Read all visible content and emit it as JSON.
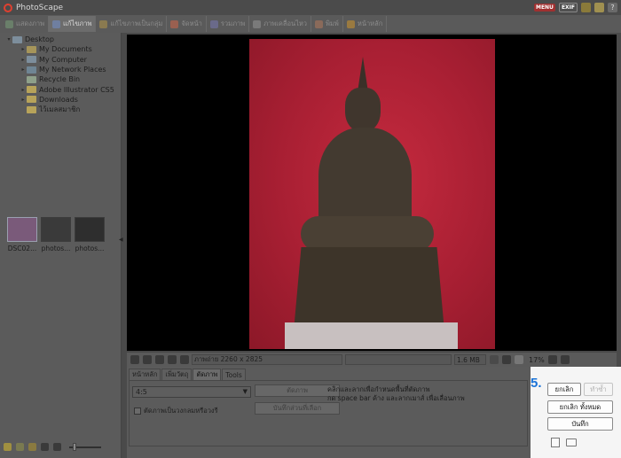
{
  "app": {
    "title": "PhotoScape"
  },
  "tabs": [
    {
      "label": "แสดงภาพ",
      "color": "#6a7f6a"
    },
    {
      "label": "แก้ไขภาพ",
      "color": "#6f7fa0",
      "active": true
    },
    {
      "label": "แก้ไขภาพเป็นกลุ่ม",
      "color": "#8a7a50"
    },
    {
      "label": "จัดหน้า",
      "color": "#9a6050"
    },
    {
      "label": "รวมภาพ",
      "color": "#6a6a8a"
    },
    {
      "label": "ภาพเคลื่อนไหว",
      "color": "#7a7a7a"
    },
    {
      "label": "พิมพ์",
      "color": "#8a6a5a"
    },
    {
      "label": "หน้าหลัก",
      "color": "#9a7a40"
    }
  ],
  "topbar": {
    "menu_label": "MENU",
    "exif_label": "EXIF"
  },
  "tree": [
    {
      "label": "Desktop",
      "level": 0,
      "icon": "desktop-icon"
    },
    {
      "label": "My Documents",
      "level": 1,
      "icon": "documents-icon"
    },
    {
      "label": "My Computer",
      "level": 1,
      "icon": "computer-icon"
    },
    {
      "label": "My Network Places",
      "level": 1,
      "icon": "network-icon"
    },
    {
      "label": "Recycle Bin",
      "level": 1,
      "icon": "recycle-bin-icon"
    },
    {
      "label": "Adobe Illustrator CS5",
      "level": 1,
      "icon": "folder-icon"
    },
    {
      "label": "Downloads",
      "level": 1,
      "icon": "folder-icon"
    },
    {
      "label": "ไว้เมลสมาชิก",
      "level": 1,
      "icon": "folder-icon"
    }
  ],
  "thumbnails": [
    {
      "label": "DSC02..."
    },
    {
      "label": "photos..."
    },
    {
      "label": "photos..."
    }
  ],
  "status": {
    "image_info": "ภาพถ่าย 2260 x 2825",
    "file_size": "1.6 MB",
    "zoom": "17%"
  },
  "panel": {
    "subtabs": [
      "หน้าหลัก",
      "เพิ่มวัตถุ",
      "ตัดภาพ",
      "Tools"
    ],
    "ratio_value": "4:5",
    "crop_button": "ตัดภาพ",
    "save_selection_button": "บันทึกส่วนที่เลือก",
    "circle_crop_label": "ตัดภาพเป็นวงกลมหรือวงรี",
    "hint_line1": "คลิกและลากเพื่อกำหนดพื้นที่ตัดภาพ",
    "hint_line2": "กด space bar ค้าง และลากเมาส์ เพื่อเลื่อนภาพ"
  },
  "actions": {
    "step_label": "5.",
    "undo": "ยกเลิก",
    "redo": "ทำซ้ำ",
    "undo_all": "ยกเลิก ทั้งหมด",
    "save": "บันทึก"
  }
}
